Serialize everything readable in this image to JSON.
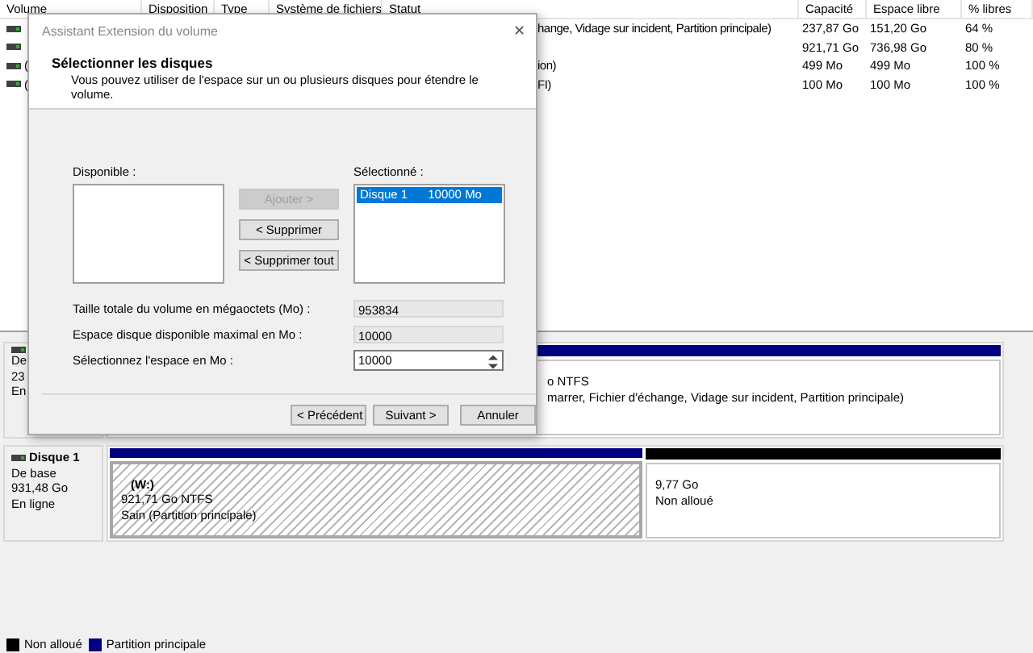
{
  "volume_table": {
    "columns": [
      "Volume",
      "Disposition",
      "Type",
      "Système de fichiers",
      "Statut",
      "Capacité",
      "Espace libre",
      "% libres"
    ],
    "rows": [
      {
        "status": "hange, Vidage sur incident, Partition principale)",
        "capacity": "237,87 Go",
        "free": "151,20 Go",
        "percent": "64 %"
      },
      {
        "capacity": "921,71 Go",
        "free": "736,98 Go",
        "percent": "80 %"
      },
      {
        "volume": "(",
        "status": "ion)",
        "capacity": "499 Mo",
        "free": "499 Mo",
        "percent": "100 %"
      },
      {
        "volume": "(",
        "status": "FI)",
        "capacity": "100 Mo",
        "free": "100 Mo",
        "percent": "100 %"
      }
    ]
  },
  "disks": [
    {
      "lines": [
        "De",
        "23",
        "En"
      ],
      "partitions": [
        {
          "kind": "primary",
          "selected": false,
          "lines": [
            "o NTFS",
            "marrer, Fichier d'échange, Vidage sur incident, Partition principale)"
          ]
        }
      ]
    },
    {
      "name": "Disque 1",
      "lines": [
        "De base",
        "931,48 Go",
        "En ligne"
      ],
      "partitions": [
        {
          "kind": "primary",
          "selected": true,
          "name": "(W:)",
          "lines": [
            "921,71 Go NTFS",
            "Sain (Partition principale)"
          ]
        },
        {
          "kind": "unallocated",
          "selected": false,
          "lines": [
            "9,77 Go",
            "Non alloué"
          ]
        }
      ]
    }
  ],
  "legend": [
    {
      "label": "Non alloué",
      "color": "#000000"
    },
    {
      "label": "Partition principale",
      "color": "#000080"
    }
  ],
  "dialog": {
    "title": "Assistant Extension du volume",
    "close": "✕",
    "heading": "Sélectionner les disques",
    "description": "Vous pouvez utiliser de l'espace sur un ou plusieurs disques pour étendre le volume.",
    "available_label": "Disponible :",
    "selected_label": "Sélectionné :",
    "move_buttons": [
      {
        "label": "Ajouter >",
        "disabled": true
      },
      {
        "label": "< Supprimer",
        "disabled": false
      },
      {
        "label": "< Supprimer tout",
        "disabled": false
      }
    ],
    "selected_items": [
      {
        "disk": "Disque 1",
        "size": "10000 Mo",
        "selected": true
      }
    ],
    "fields": [
      {
        "kind": "readonly",
        "label": "Taille totale du volume en mégaoctets (Mo) :",
        "value": "953834"
      },
      {
        "kind": "readonly",
        "label": "Espace disque disponible maximal en Mo :",
        "value": "10000"
      },
      {
        "kind": "spin",
        "label": "Sélectionnez l'espace en Mo :",
        "value": "10000"
      }
    ],
    "nav_buttons": [
      {
        "label": "< Précédent",
        "disabled": false
      },
      {
        "label": "Suivant >",
        "disabled": false
      },
      {
        "label": "Annuler",
        "disabled": false
      }
    ]
  }
}
